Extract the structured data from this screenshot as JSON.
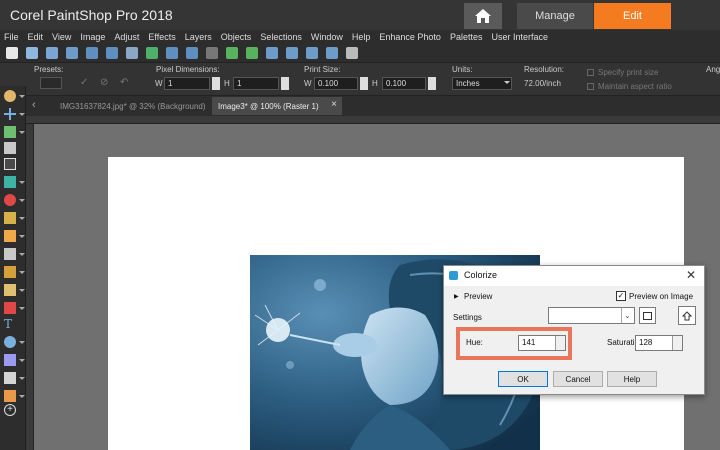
{
  "app": {
    "title": "Corel PaintShop Pro 2018",
    "mode_tabs": {
      "manage": "Manage",
      "edit": "Edit"
    },
    "accent_color": "#f47b20"
  },
  "menu": [
    "File",
    "Edit",
    "View",
    "Image",
    "Adjust",
    "Effects",
    "Layers",
    "Objects",
    "Selections",
    "Window",
    "Help",
    "Enhance Photo",
    "Palettes",
    "User Interface"
  ],
  "tool_options": {
    "presets_label": "Presets:",
    "pixel_dimensions_label": "Pixel Dimensions:",
    "w_label": "W",
    "w_value": "1",
    "h_label": "H",
    "h_value": "1",
    "print_size_label": "Print Size:",
    "print_w_label": "W",
    "print_w_value": "0.100",
    "print_h_label": "H",
    "print_h_value": "0.100",
    "units_label": "Units:",
    "units_value": "Inches",
    "resolution_label": "Resolution:",
    "resolution_value": "72.00/inch",
    "specify_print_size": "Specify print size",
    "maintain_aspect_ratio": "Maintain aspect ratio",
    "angle_label": "Angle"
  },
  "documents": {
    "tab1": "IMG31637824.jpg* @ 32% (Background)",
    "tab2": "Image3* @ 100% (Raster 1)",
    "tab2_close": "×"
  },
  "dialog": {
    "title": "Colorize",
    "close": "✕",
    "preview_label": "Preview",
    "preview_on_image_label": "Preview on Image",
    "preview_on_image_checked": true,
    "settings_label": "Settings",
    "settings_value": "",
    "hue_label": "Hue:",
    "hue_value": "141",
    "saturation_label": "Saturation:",
    "saturation_value": "128",
    "ok_label": "OK",
    "cancel_label": "Cancel",
    "help_label": "Help",
    "highlight_color": "#e8775a"
  }
}
